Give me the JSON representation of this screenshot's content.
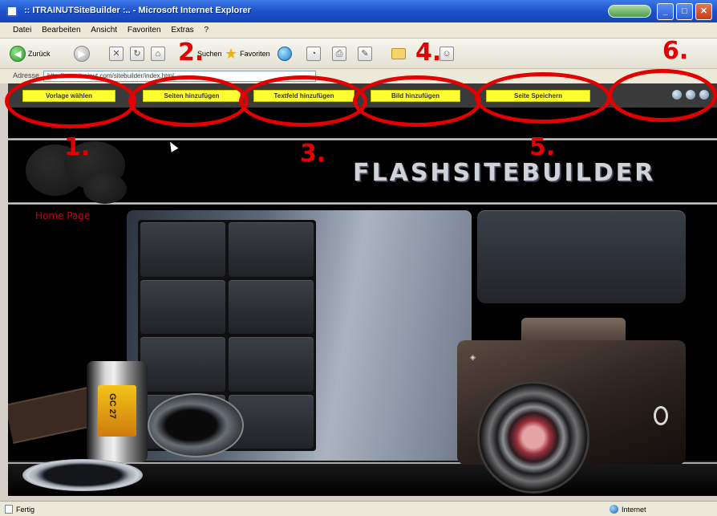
{
  "window": {
    "title": ":: ITRAINUTSiteBuilder :.. - Microsoft Internet Explorer"
  },
  "menu": [
    "Datei",
    "Bearbeiten",
    "Ansicht",
    "Favoriten",
    "Extras",
    "?"
  ],
  "toolbar": {
    "back_label": "Zurück",
    "search_label": "Suchen",
    "favorites_label": "Favoriten"
  },
  "address": {
    "label": "Adresse",
    "url": "http://www.itrainut.com/sitebuilder/index.html"
  },
  "app_toolbar": {
    "buttons": [
      "Vorlage wählen",
      "Seiten hinzufügen",
      "Textfeld hinzufügen",
      "Bild hinzufügen",
      "Seite Speichern"
    ]
  },
  "content": {
    "brand": "FLASHSITEBUILDER",
    "home_label": "Home Page",
    "film_text": "GC 27"
  },
  "annotations": [
    "1.",
    "2.",
    "3.",
    "4.",
    "5.",
    "6."
  ],
  "status": {
    "left": "Fertig",
    "right": "Internet"
  },
  "colors": {
    "annotation": "#e20000",
    "app_button": "#ffff33",
    "titlebar": "#1b4fc9"
  }
}
